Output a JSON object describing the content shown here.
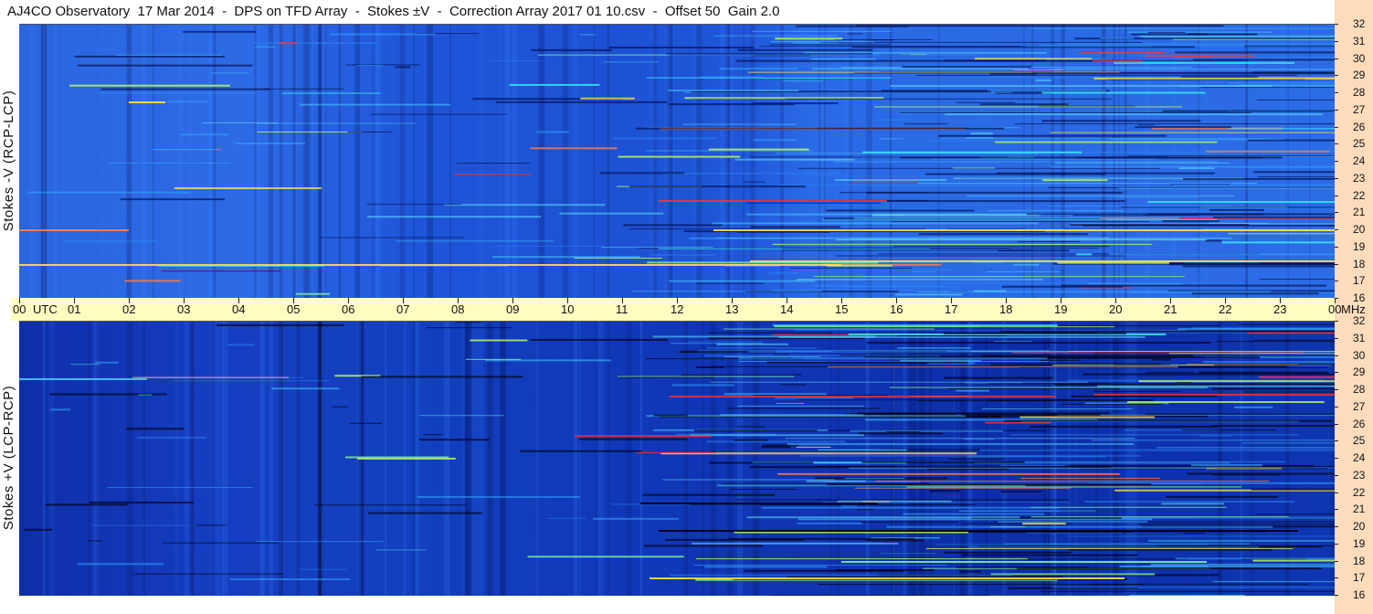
{
  "title": "AJ4CO Observatory  17 Mar 2014  -  DPS on TFD Array  -  Stokes ±V  -  Correction Array 2017 01 10.csv  -  Offset 50  Gain 2.0",
  "colors": {
    "background": "#ffffff",
    "time_axis_band": "#fffcc2",
    "frequency_axis_band": "#fddcbc",
    "colormap_low": "#000840",
    "colormap_mid": "#1f55d8",
    "colormap_high": "#ffe04a",
    "colormap_peak": "#ff4030"
  },
  "chart_data": {
    "type": "heatmap",
    "panels": [
      {
        "ylabel": "Stokes -V (RCP-LCP)",
        "y_ticks": [
          "32",
          "31",
          "30",
          "29",
          "28",
          "27",
          "26",
          "25",
          "24",
          "23",
          "22",
          "21",
          "20",
          "19",
          "18",
          "17",
          "16"
        ],
        "ylim": [
          16,
          32
        ],
        "x_ticks": [
          "00",
          "01",
          "02",
          "03",
          "04",
          "05",
          "06",
          "07",
          "08",
          "09",
          "10",
          "11",
          "12",
          "13",
          "14",
          "15",
          "16",
          "17",
          "18",
          "19",
          "20",
          "21",
          "22",
          "23",
          "00"
        ]
      },
      {
        "ylabel": "Stokes +V (LCP-RCP)",
        "y_ticks": [
          "32",
          "31",
          "30",
          "29",
          "28",
          "27",
          "26",
          "25",
          "24",
          "23",
          "22",
          "21",
          "20",
          "19",
          "18",
          "17",
          "16"
        ],
        "ylim": [
          16,
          32
        ],
        "x_ticks": [
          "00",
          "01",
          "02",
          "03",
          "04",
          "05",
          "06",
          "07",
          "08",
          "09",
          "10",
          "11",
          "12",
          "13",
          "14",
          "15",
          "16",
          "17",
          "18",
          "19",
          "20",
          "21",
          "22",
          "23",
          "00"
        ]
      }
    ],
    "x_unit": "UTC",
    "y_unit": "MHz",
    "xlim": [
      0,
      24
    ],
    "colormap": "jet",
    "grid": false
  }
}
